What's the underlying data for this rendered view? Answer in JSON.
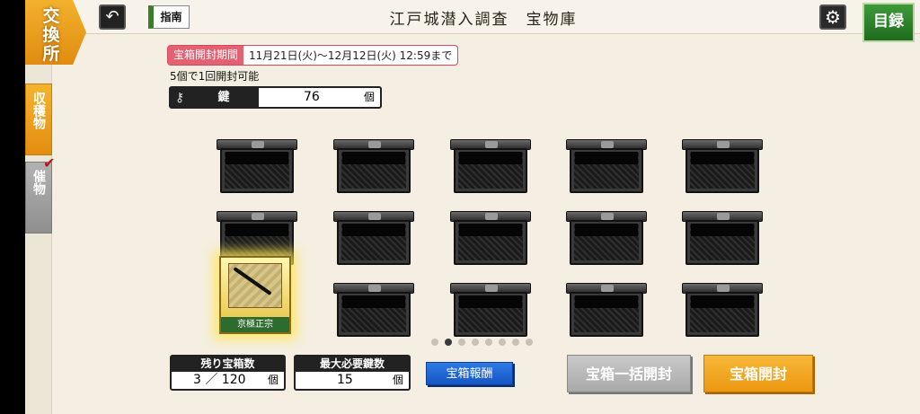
{
  "header": {
    "title": "江戸城潜入調査　宝物庫",
    "exchange_label": [
      "交",
      "換",
      "所"
    ],
    "guide_label": "指南",
    "back_icon": "back-arrow-icon",
    "settings_icon": "gear-icon",
    "catalog_label": "目録"
  },
  "side_tabs": {
    "collect_label": "収穫物",
    "event_label": "催物"
  },
  "period": {
    "label": "宝箱開封期間",
    "value": "11月21日(火)～12月12日(火) 12:59まで"
  },
  "open_note": "5個で1回開封可能",
  "keys": {
    "label": "鍵",
    "count": "76",
    "unit": "個"
  },
  "reward": {
    "name": "京極正宗"
  },
  "pagination": {
    "total": 8,
    "current": 2
  },
  "stats": {
    "remaining_label": "残り宝箱数",
    "remaining_value": "3 ／ 120",
    "remaining_unit": "個",
    "max_keys_label": "最大必要鍵数",
    "max_keys_value": "15",
    "max_keys_unit": "個"
  },
  "buttons": {
    "reward_label": "宝箱報酬",
    "bulk_open_label": "宝箱一括開封",
    "open_label": "宝箱開封"
  },
  "colors": {
    "accent_orange": "#eb970f",
    "catalog_green": "#2f7d2a",
    "reward_blue": "#1f66d6",
    "period_pink": "#e26172"
  }
}
